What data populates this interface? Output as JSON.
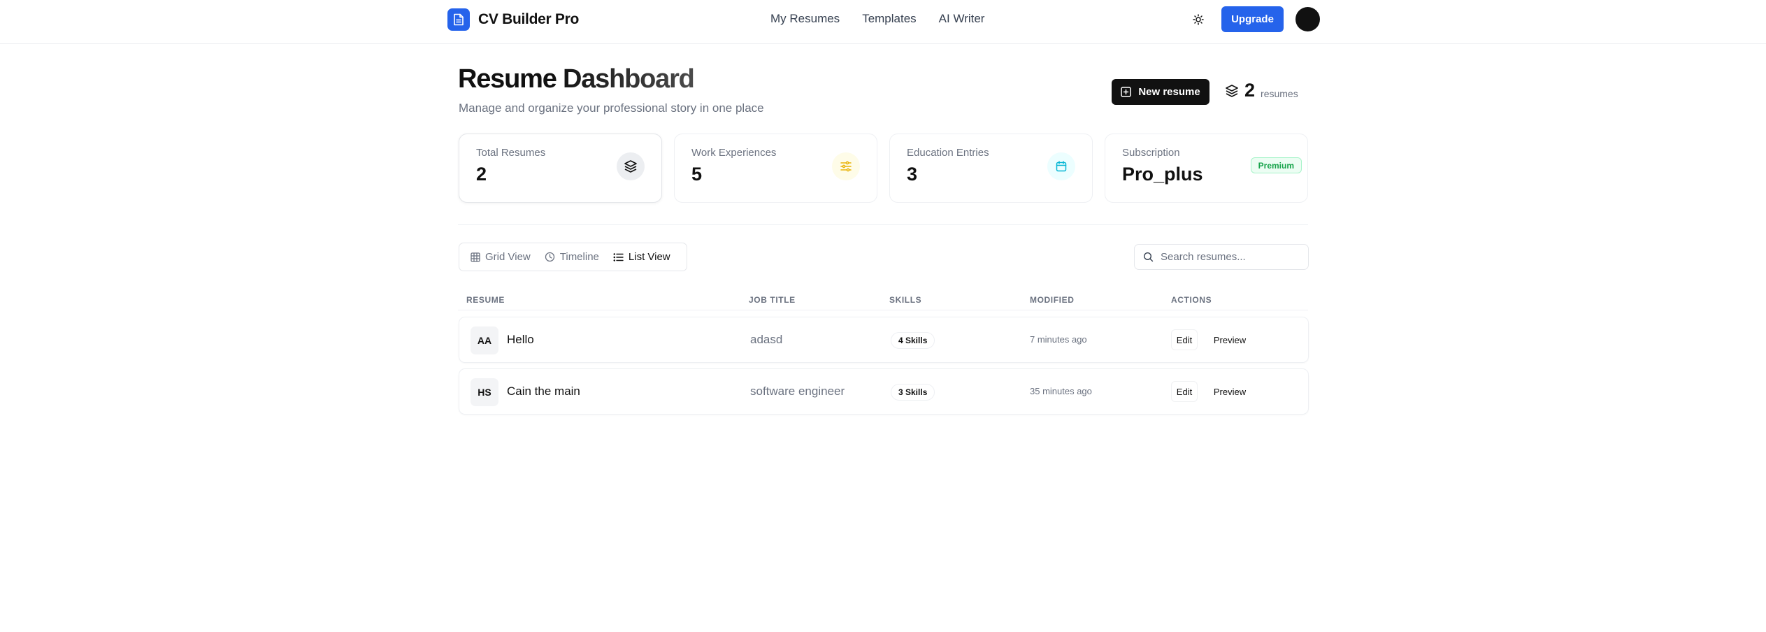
{
  "header": {
    "app_name": "CV Builder Pro",
    "logo_icon": "document-icon",
    "nav": [
      "My Resumes",
      "Templates",
      "AI Writer"
    ],
    "theme_icon": "sun-icon",
    "upgrade_label": "Upgrade",
    "accent": "#2563eb"
  },
  "page": {
    "title": "Resume Dashboard",
    "subtitle": "Manage and organize your professional story in one place",
    "new_button": "New resume",
    "resume_count": "2",
    "resume_count_label": "resumes"
  },
  "stats": [
    {
      "label": "Total Resumes",
      "value": "2",
      "icon": "layers-icon",
      "icon_bg": "#f3f4f6",
      "icon_color": "#111827"
    },
    {
      "label": "Work Experiences",
      "value": "5",
      "icon": "sliders-icon",
      "icon_bg": "#fefce8",
      "icon_color": "#eab308"
    },
    {
      "label": "Education Entries",
      "value": "3",
      "icon": "calendar-icon",
      "icon_bg": "#ecfeff",
      "icon_color": "#06b6d4"
    },
    {
      "label": "Subscription",
      "value": "Pro_plus",
      "badge": "Premium",
      "badge_color": "#16a34a"
    }
  ],
  "views": {
    "items": [
      "Grid View",
      "Timeline",
      "List View"
    ],
    "active": "List View"
  },
  "search": {
    "placeholder": "Search resumes...",
    "value": ""
  },
  "table": {
    "columns": [
      "Resume",
      "Job Title",
      "Skills",
      "Modified",
      "Actions"
    ],
    "rows": [
      {
        "initials": "AA",
        "name": "Hello",
        "job_title": "adasd",
        "skills": "4 Skills",
        "modified": "7 minutes ago",
        "edit": "Edit",
        "preview": "Preview"
      },
      {
        "initials": "HS",
        "name": "Cain the main",
        "job_title": "software engineer",
        "skills": "3 Skills",
        "modified": "35 minutes ago",
        "edit": "Edit",
        "preview": "Preview"
      }
    ]
  }
}
